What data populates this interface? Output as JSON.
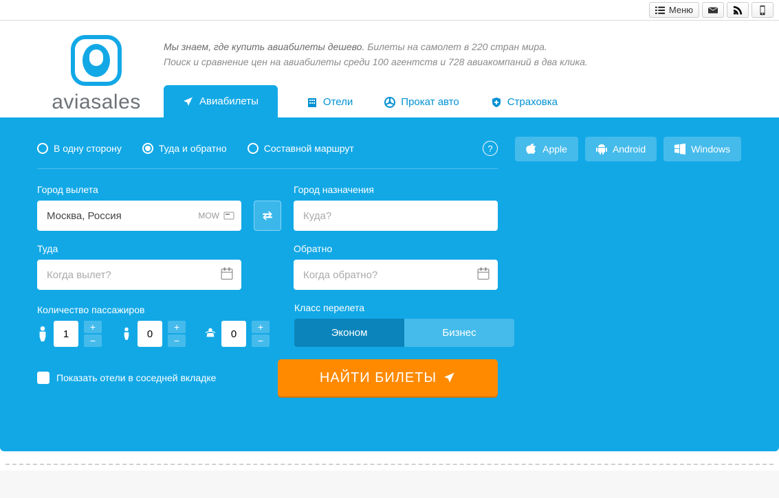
{
  "topbar": {
    "menu_label": "Меню"
  },
  "brand": "aviasales",
  "slogan": {
    "line1_em": "Мы знаем, где купить авиабилеты дешево.",
    "line1_rest": " Билеты на самолет в 220 стран мира.",
    "line2": "Поиск и сравнение цен на авиабилеты среди 100 агентств и 728 авиакомпаний в два клика."
  },
  "tabs": {
    "flights": "Авиабилеты",
    "hotels": "Отели",
    "cars": "Прокат авто",
    "insurance": "Страховка"
  },
  "trip_types": {
    "oneway": "В одну сторону",
    "round": "Туда и обратно",
    "multi": "Составной маршрут"
  },
  "help": "?",
  "apps": {
    "apple": "Apple",
    "android": "Android",
    "windows": "Windows"
  },
  "form": {
    "from_label": "Город вылета",
    "from_value": "Москва, Россия",
    "from_code": "MOW",
    "to_label": "Город назначения",
    "to_placeholder": "Куда?",
    "depart_label": "Туда",
    "depart_placeholder": "Когда вылет?",
    "return_label": "Обратно",
    "return_placeholder": "Когда обратно?",
    "pax_label": "Количество пассажиров",
    "adults": "1",
    "children": "0",
    "infants": "0",
    "class_label": "Класс перелета",
    "economy": "Эконом",
    "business": "Бизнес",
    "show_hotels": "Показать отели в соседней вкладке",
    "search": "НАЙТИ БИЛЕТЫ"
  }
}
